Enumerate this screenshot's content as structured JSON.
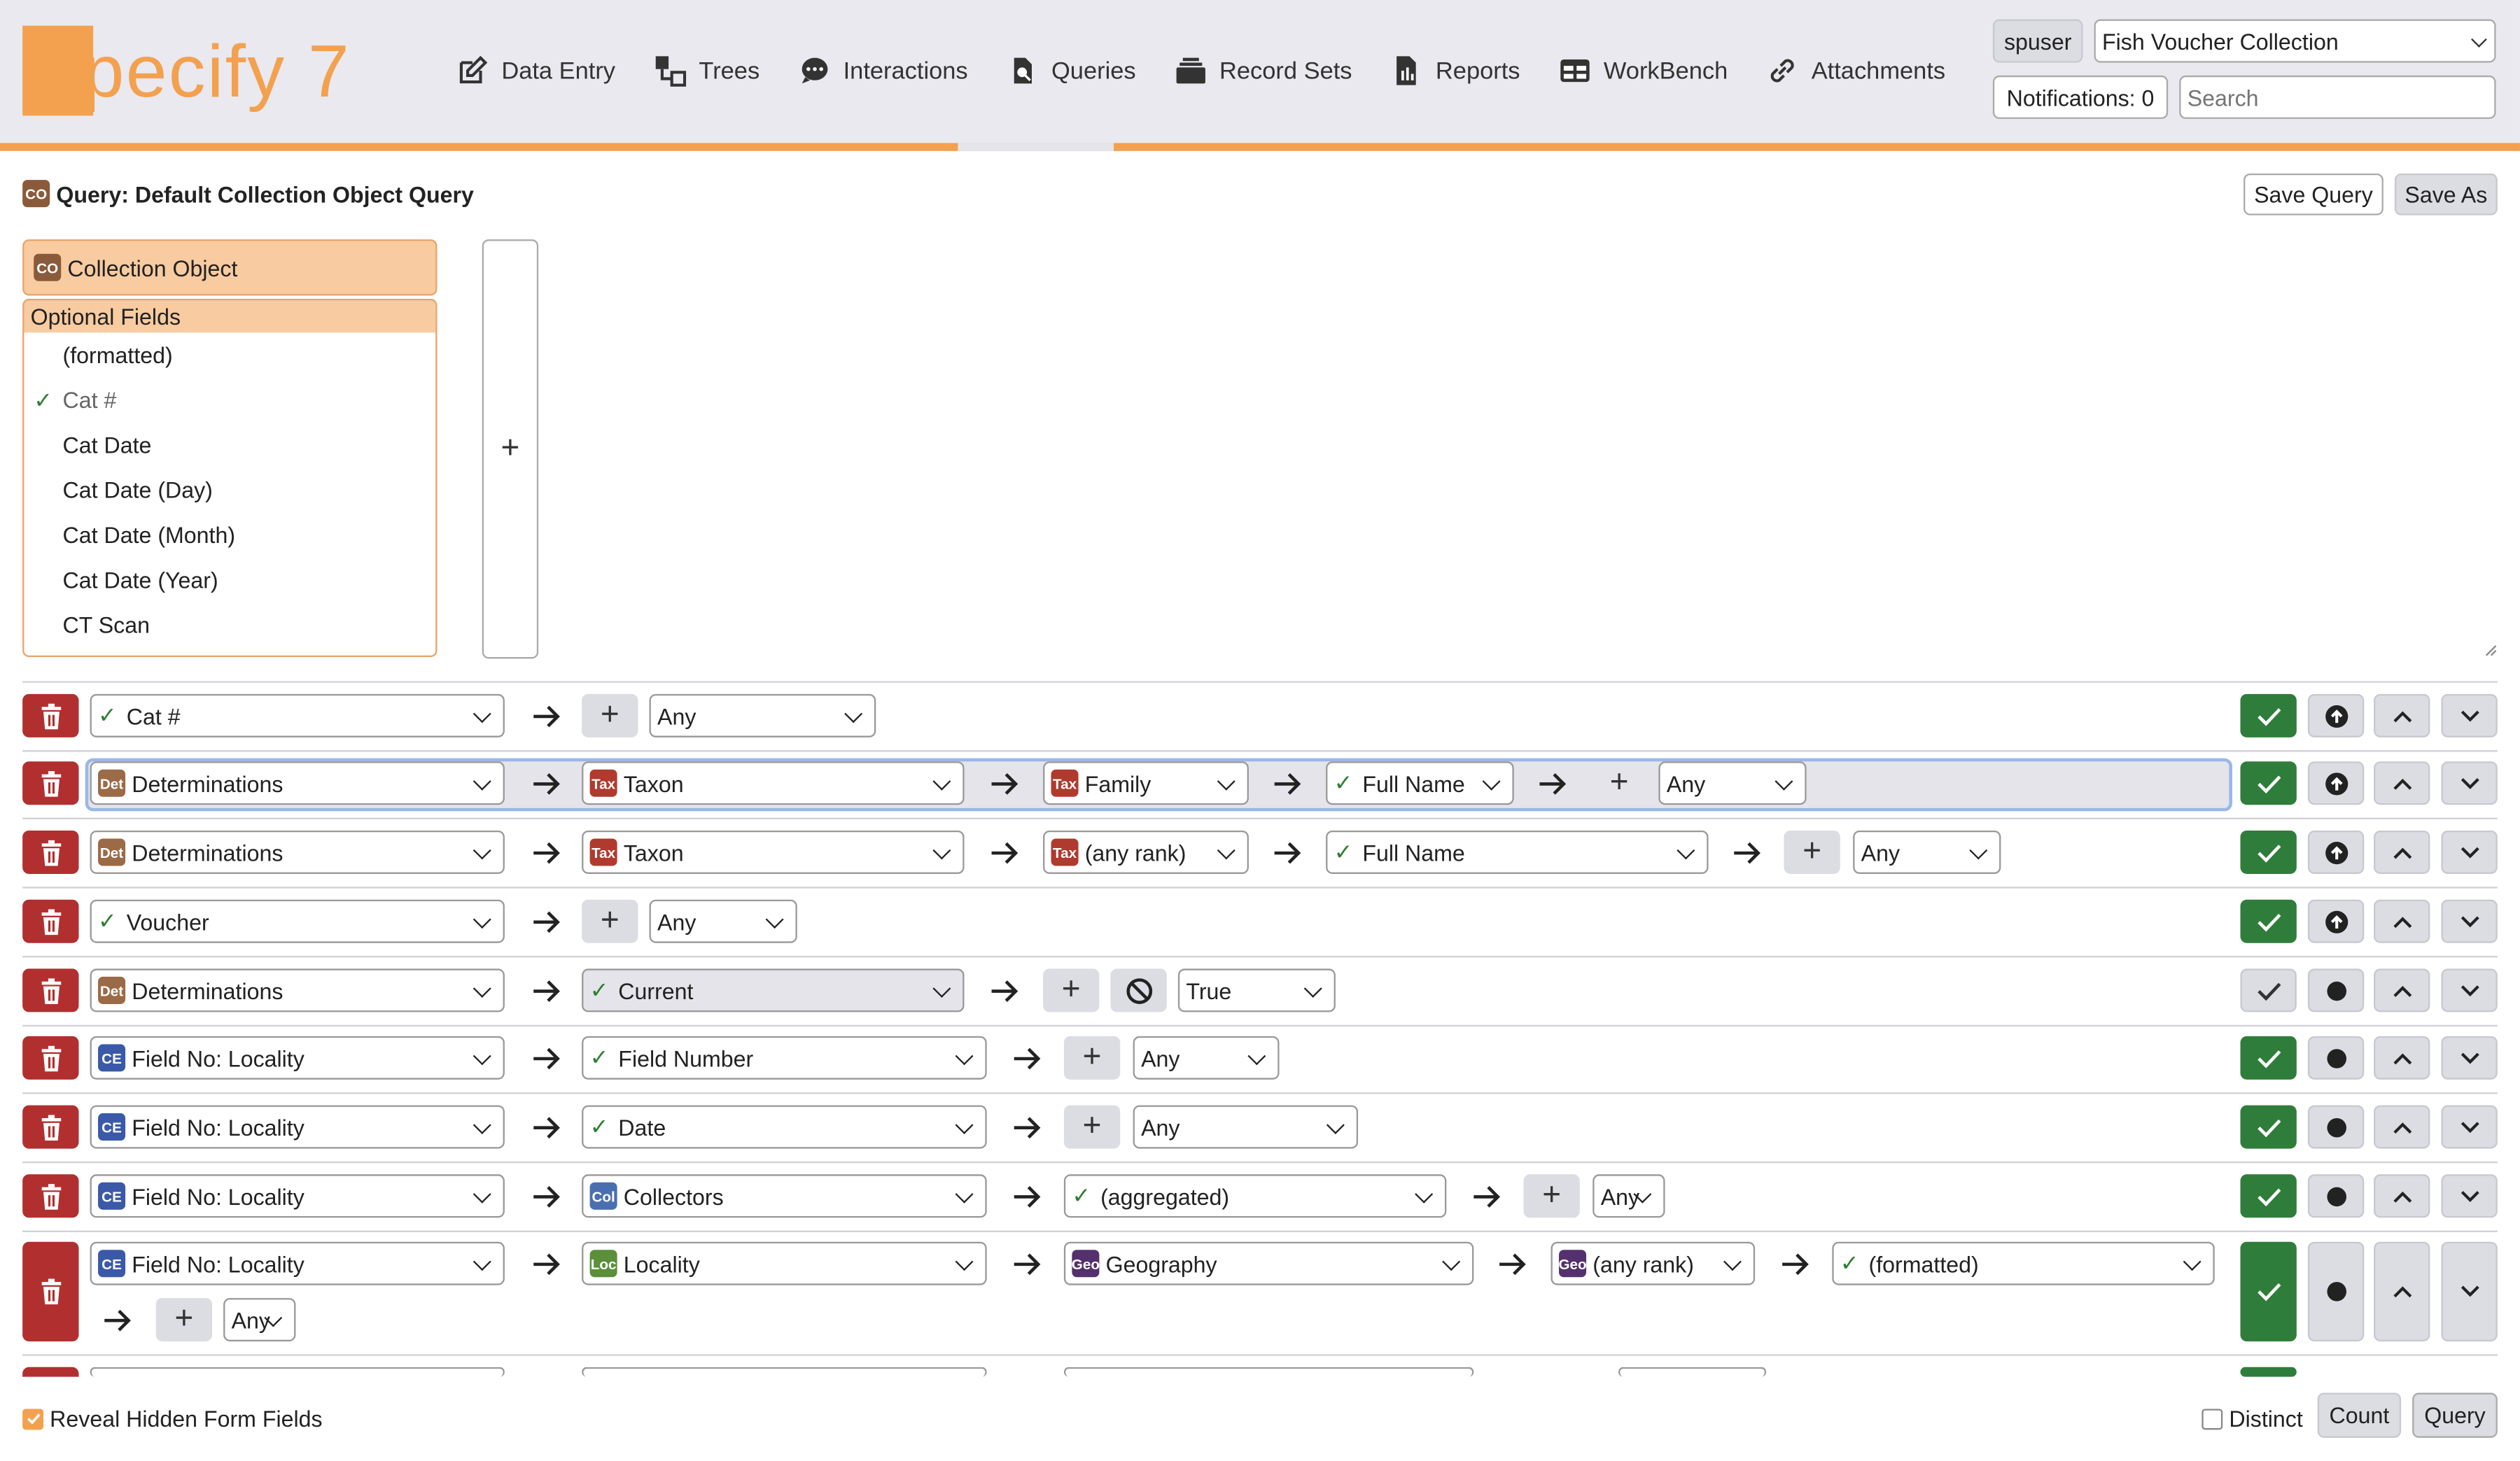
{
  "header": {
    "logo_text": "Specify 7",
    "nav": [
      {
        "label": "Data Entry",
        "icon": "pencil-square-icon"
      },
      {
        "label": "Trees",
        "icon": "tree-icon"
      },
      {
        "label": "Interactions",
        "icon": "chat-icon"
      },
      {
        "label": "Queries",
        "icon": "search-icon"
      },
      {
        "label": "Record Sets",
        "icon": "collection-icon"
      },
      {
        "label": "Reports",
        "icon": "document-report-icon"
      },
      {
        "label": "WorkBench",
        "icon": "table-icon"
      },
      {
        "label": "Attachments",
        "icon": "link-icon"
      }
    ],
    "active_nav": "Queries",
    "user": "spuser",
    "collection": "Fish Voucher Collection",
    "notifications": "Notifications: 0",
    "search_placeholder": "Search"
  },
  "query": {
    "title": "Query: Default Collection Object Query",
    "save_label": "Save Query",
    "save_as_label": "Save As"
  },
  "table_panel": {
    "table_name": "Collection Object",
    "optional_fields_label": "Optional Fields",
    "fields": [
      {
        "label": "(formatted)",
        "checked": false
      },
      {
        "label": "Cat #",
        "checked": true
      },
      {
        "label": "Cat Date",
        "checked": false
      },
      {
        "label": "Cat Date (Day)",
        "checked": false
      },
      {
        "label": "Cat Date (Month)",
        "checked": false
      },
      {
        "label": "Cat Date (Year)",
        "checked": false
      },
      {
        "label": "CT Scan",
        "checked": false
      }
    ],
    "add_label": "+"
  },
  "lines": [
    {
      "cells": [
        "Cat #",
        "Any"
      ]
    },
    {
      "cells": [
        "Determinations",
        "Taxon",
        "Family",
        "Full Name",
        "Any"
      ]
    },
    {
      "cells": [
        "Determinations",
        "Taxon",
        "(any rank)",
        "Full Name",
        "Any"
      ]
    },
    {
      "cells": [
        "Voucher",
        "Any"
      ]
    },
    {
      "cells": [
        "Determinations",
        "Current",
        "True"
      ]
    },
    {
      "cells": [
        "Field No: Locality",
        "Field Number",
        "Any"
      ]
    },
    {
      "cells": [
        "Field No: Locality",
        "Date",
        "Any"
      ]
    },
    {
      "cells": [
        "Field No: Locality",
        "Collectors",
        "(aggregated)",
        "Any"
      ]
    },
    {
      "cells": [
        "Field No: Locality",
        "Locality",
        "Geography",
        "(any rank)",
        "(formatted)",
        "Any"
      ]
    }
  ],
  "footer": {
    "reveal_label": "Reveal Hidden Form Fields",
    "reveal_checked": true,
    "distinct_label": "Distinct",
    "distinct_checked": false,
    "count_label": "Count",
    "query_label": "Query"
  },
  "colors": {
    "accent": "#f3a14f",
    "delete": "#b22f2f",
    "display_on": "#2f7d3a"
  }
}
